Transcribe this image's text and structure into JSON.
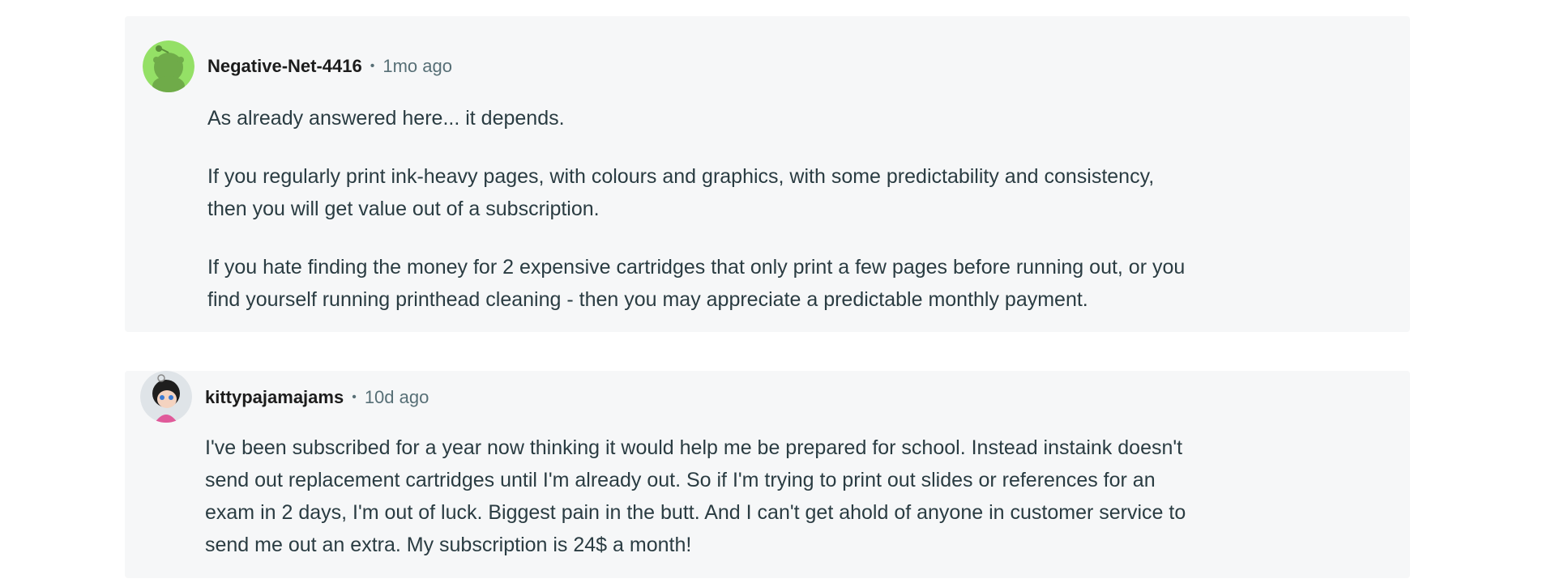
{
  "comments": [
    {
      "username": "Negative-Net-4416",
      "separator": "•",
      "time": "1mo ago",
      "avatar_icon": "reddit-snoo-green-avatar",
      "paragraphs": [
        [
          "As already answered here... it depends."
        ],
        [
          "If you regularly print ink-heavy pages, with colours and graphics, with some predictability and consistency,",
          "then you will get value out of a subscription."
        ],
        [
          "If you hate finding the money for 2 expensive cartridges that only print a few pages before running out, or you",
          "find yourself running printhead cleaning - then you may appreciate a predictable monthly payment."
        ]
      ]
    },
    {
      "username": "kittypajamajams",
      "separator": "•",
      "time": "10d ago",
      "avatar_icon": "cartoon-girl-avatar",
      "paragraphs": [
        [
          "I've been subscribed for a year now thinking it would help me be prepared for school. Instead instaink doesn't",
          "send out replacement cartridges until I'm already out. So if I'm trying to print out slides or references for an",
          "exam in 2 days, I'm out of luck. Biggest pain in the butt. And I can't get ahold of anyone in customer service to",
          "send me out an extra. My subscription is 24$ a month!"
        ]
      ]
    }
  ]
}
